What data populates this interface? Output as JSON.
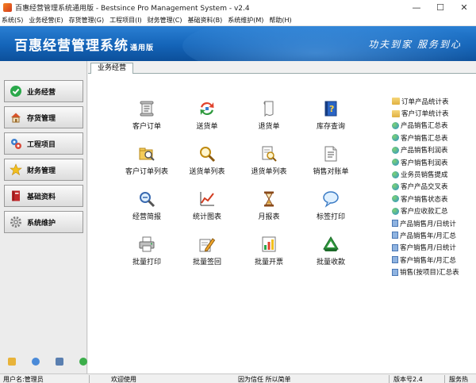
{
  "window": {
    "title": "百惠经营管理系统通用版 - Bestsince Pro Management System - v2.4",
    "min_label": "—",
    "max_label": "☐",
    "close_label": "✕"
  },
  "menu": [
    "系统(S)",
    "业务经营(E)",
    "存货管理(G)",
    "工程项目(I)",
    "财务管理(C)",
    "基础资料(B)",
    "系统维护(M)",
    "帮助(H)"
  ],
  "banner": {
    "product_name": "百惠经营管理系统",
    "edition": "通用版",
    "slogan": "功夫到家 服务到心"
  },
  "left_nav": {
    "items": [
      {
        "label": "业务经营",
        "icon": "check-circle-icon",
        "color": "#2aa84a"
      },
      {
        "label": "存货管理",
        "icon": "house-icon",
        "color": "#d9532a"
      },
      {
        "label": "工程项目",
        "icon": "gears-icon",
        "color": "#3b7fcf"
      },
      {
        "label": "财务管理",
        "icon": "star-icon",
        "color": "#f2c01e"
      },
      {
        "label": "基础资料",
        "icon": "book-icon",
        "color": "#c0282a"
      },
      {
        "label": "系统维护",
        "icon": "gear-icon",
        "color": "#808080"
      }
    ],
    "bottom_icons": [
      "notes-icon",
      "info-icon",
      "monitor-icon",
      "refresh-icon"
    ]
  },
  "tab": {
    "label": "业务经营"
  },
  "functions": [
    {
      "label": "客户订单",
      "icon": "scroll-icon"
    },
    {
      "label": "送货单",
      "icon": "arrows-cycle-icon"
    },
    {
      "label": "退货单",
      "icon": "paper-icon"
    },
    {
      "label": "库存查询",
      "icon": "help-book-icon"
    },
    {
      "label": "客户订单列表",
      "icon": "search-folder-icon"
    },
    {
      "label": "送货单列表",
      "icon": "magnifier-icon"
    },
    {
      "label": "退货单列表",
      "icon": "search-doc-icon"
    },
    {
      "label": "销售对账单",
      "icon": "document-icon"
    },
    {
      "label": "经营简报",
      "icon": "zoom-icon"
    },
    {
      "label": "统计图表",
      "icon": "line-chart-icon"
    },
    {
      "label": "月报表",
      "icon": "hourglass-icon"
    },
    {
      "label": "标签打印",
      "icon": "speech-bubble-icon"
    },
    {
      "label": "批量打印",
      "icon": "printer-icon"
    },
    {
      "label": "批量签回",
      "icon": "pencil-edit-icon"
    },
    {
      "label": "批量开票",
      "icon": "bar-chart-icon"
    },
    {
      "label": "批量收款",
      "icon": "recycle-icon"
    }
  ],
  "reports": [
    {
      "label": "订单产品统计表",
      "icon": "folder-icon"
    },
    {
      "label": "客户订单统计表",
      "icon": "folder-icon"
    },
    {
      "label": "产品销售汇总表",
      "icon": "globe-icon"
    },
    {
      "label": "客户销售汇总表",
      "icon": "globe-icon"
    },
    {
      "label": "产品销售利润表",
      "icon": "globe-icon"
    },
    {
      "label": "客户销售利润表",
      "icon": "globe-icon"
    },
    {
      "label": "业务员销售提成",
      "icon": "globe-icon"
    },
    {
      "label": "客户产品交叉表",
      "icon": "globe-icon"
    },
    {
      "label": "客户销售状态表",
      "icon": "globe-icon"
    },
    {
      "label": "客户应收款汇总",
      "icon": "globe-icon"
    },
    {
      "label": "产品销售月/日统计",
      "icon": "doc-icon"
    },
    {
      "label": "产品销售年/月汇总",
      "icon": "doc-icon"
    },
    {
      "label": "客户销售月/日统计",
      "icon": "doc-icon"
    },
    {
      "label": "客户销售年/月汇总",
      "icon": "doc-icon"
    },
    {
      "label": "销售(按项目)汇总表",
      "icon": "doc-icon"
    }
  ],
  "status": {
    "user": "用户名:管理员",
    "welcome": "欢迎使用",
    "motto": "因为信任 所以简单",
    "version": "版本号2.4",
    "service": "服务热"
  },
  "colors": {
    "banner": "#1464b8",
    "content_bg": "#ffffff"
  }
}
